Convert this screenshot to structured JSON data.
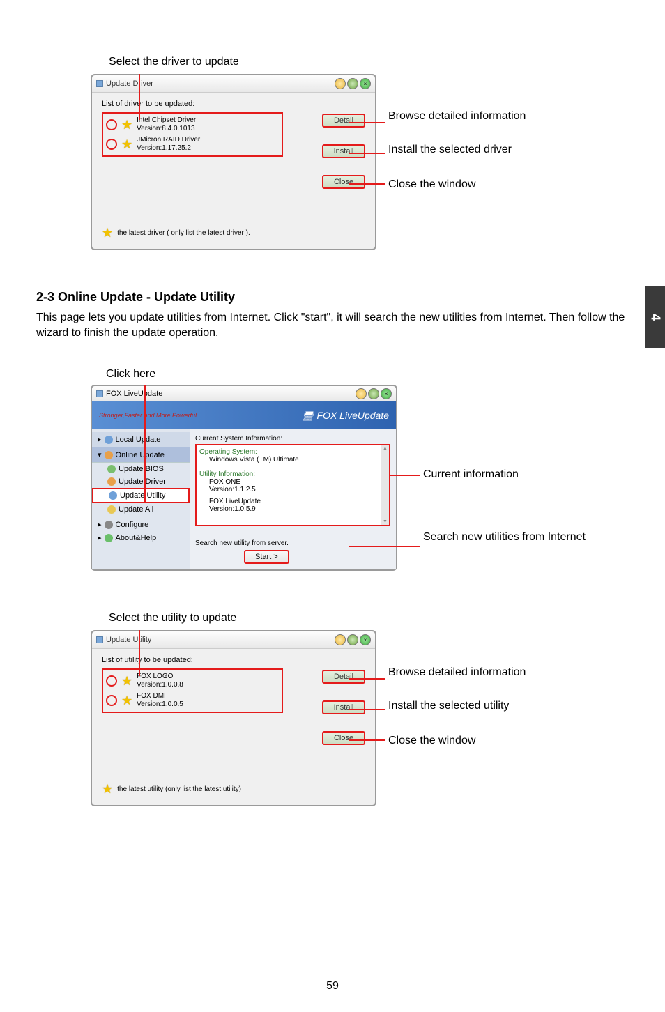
{
  "page_num": "59",
  "side_tab": "4",
  "fig1": {
    "caption": "Select the driver to update",
    "title": "Update Driver",
    "list_label": "List of driver to be updated:",
    "items": [
      {
        "name": "Intel Chipset Driver",
        "ver": "Version:8.4.0.1013"
      },
      {
        "name": "JMicron RAID Driver",
        "ver": "Version:1.17.25.2"
      }
    ],
    "btn_detail": "Detail",
    "btn_install": "Install",
    "btn_close": "Close",
    "latest_note": "the latest driver ( only list the latest driver ).",
    "c_detail": "Browse detailed information",
    "c_install": "Install the selected driver",
    "c_close": "Close the window"
  },
  "section": {
    "heading": "2-3 Online Update - Update Utility",
    "p1": "This page lets you update utilities from Internet. Click \"start\", it will search the new utilities from Internet. Then follow the wizard to finish the update operation."
  },
  "fig2": {
    "click_here": "Click here",
    "title": "FOX LiveUpdate",
    "slogan": "Stronger,Faster and More Powerful",
    "banner_title": "FOX LiveUpdate",
    "nav": {
      "local": "Local Update",
      "online": "Online Update",
      "bios": "Update BIOS",
      "driver": "Update Driver",
      "utility": "Update Utility",
      "all": "Update All",
      "configure": "Configure",
      "abouthelp": "About&Help"
    },
    "info_header": "Current System Information:",
    "os_h": "Operating System:",
    "os_v": "Windows Vista (TM) Ultimate",
    "util_h": "Utility Information:",
    "u1": "FOX ONE",
    "u1v": "Version:1.1.2.5",
    "u2": "FOX LiveUpdate",
    "u2v": "Version:1.0.5.9",
    "search_label": "Search new utility from server.",
    "start": "Start  >",
    "c_info": "Current information",
    "c_search": "Search new utilities from Internet"
  },
  "fig3": {
    "caption": "Select the utility to update",
    "title": "Update Utility",
    "list_label": "List of utility to be updated:",
    "items": [
      {
        "name": "FOX LOGO",
        "ver": "Version:1.0.0.8"
      },
      {
        "name": "FOX DMI",
        "ver": "Version:1.0.0.5"
      }
    ],
    "btn_detail": "Detail",
    "btn_install": "Install",
    "btn_close": "Close",
    "latest_note": "the latest utility (only list the latest utility)",
    "c_detail": "Browse detailed information",
    "c_install": "Install the selected utility",
    "c_close": "Close the window"
  }
}
